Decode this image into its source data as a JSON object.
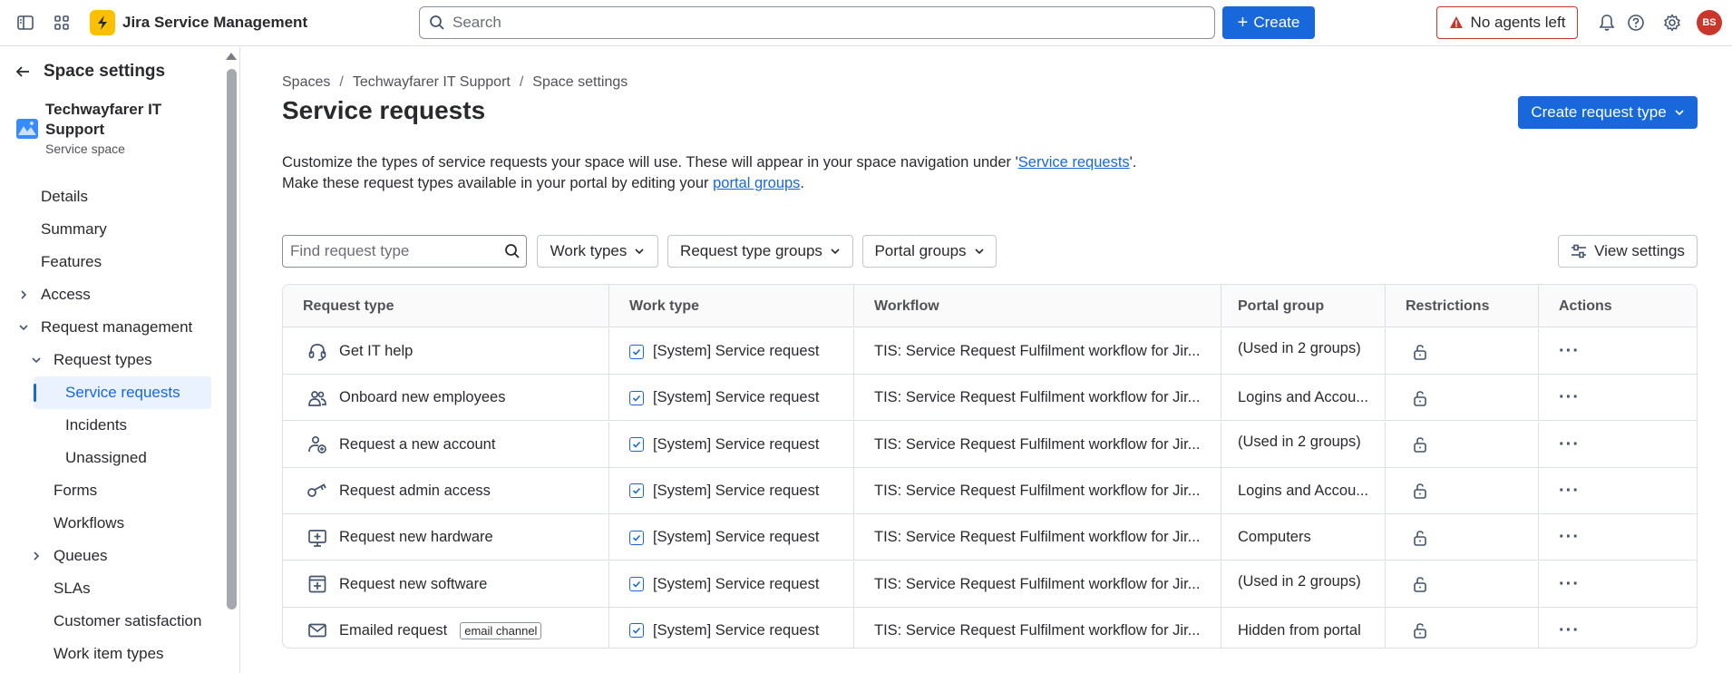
{
  "topnav": {
    "brand": "Jira Service Management",
    "search_placeholder": "Search",
    "create_label": "Create",
    "agents_label": "No agents left",
    "avatar_initials": "BS"
  },
  "sidebar": {
    "title": "Space settings",
    "space_name": "Techwayfarer IT Support",
    "space_type": "Service space",
    "items": {
      "details": "Details",
      "summary": "Summary",
      "features": "Features",
      "access": "Access",
      "request_management": "Request management",
      "request_types": "Request types",
      "service_requests": "Service requests",
      "incidents": "Incidents",
      "unassigned": "Unassigned",
      "forms": "Forms",
      "workflows": "Workflows",
      "queues": "Queues",
      "slas": "SLAs",
      "customer_satisfaction": "Customer satisfaction",
      "work_item_types": "Work item types"
    }
  },
  "main": {
    "breadcrumb": [
      "Spaces",
      "Techwayfarer IT Support",
      "Space settings"
    ],
    "title": "Service requests",
    "create_request_type": "Create request type",
    "desc_line1_pre": "Customize the types of service requests your space will use. These will appear in your space navigation under '",
    "desc_line1_link": "Service requests",
    "desc_line1_post": "'.",
    "desc_line2_pre": "Make these request types available in your portal by editing your ",
    "desc_line2_link": "portal groups",
    "desc_line2_post": ".",
    "find_placeholder": "Find request type",
    "filters": {
      "work_types": "Work types",
      "request_type_groups": "Request type groups",
      "portal_groups": "Portal groups"
    },
    "view_settings": "View settings",
    "table": {
      "headers": {
        "request_type": "Request type",
        "work_type": "Work type",
        "workflow": "Workflow",
        "portal_group": "Portal group",
        "restrictions": "Restrictions",
        "actions": "Actions"
      },
      "rows": [
        {
          "icon": "headset-icon",
          "name": "Get IT help",
          "badge": "",
          "work_type": "[System] Service request",
          "workflow": "TIS: Service Request Fulfilment workflow for Jir...",
          "portal_group": "(Used in 2 groups)"
        },
        {
          "icon": "people-icon",
          "name": "Onboard new employees",
          "badge": "",
          "work_type": "[System] Service request",
          "workflow": "TIS: Service Request Fulfilment workflow for Jir...",
          "portal_group": "Logins and Accou..."
        },
        {
          "icon": "person-add-icon",
          "name": "Request a new account",
          "badge": "",
          "work_type": "[System] Service request",
          "workflow": "TIS: Service Request Fulfilment workflow for Jir...",
          "portal_group": "(Used in 2 groups)"
        },
        {
          "icon": "key-icon",
          "name": "Request admin access",
          "badge": "",
          "work_type": "[System] Service request",
          "workflow": "TIS: Service Request Fulfilment workflow for Jir...",
          "portal_group": "Logins and Accou..."
        },
        {
          "icon": "monitor-add-icon",
          "name": "Request new hardware",
          "badge": "",
          "work_type": "[System] Service request",
          "workflow": "TIS: Service Request Fulfilment workflow for Jir...",
          "portal_group": "Computers"
        },
        {
          "icon": "window-add-icon",
          "name": "Request new software",
          "badge": "",
          "work_type": "[System] Service request",
          "workflow": "TIS: Service Request Fulfilment workflow for Jir...",
          "portal_group": "(Used in 2 groups)"
        },
        {
          "icon": "email-icon",
          "name": "Emailed request",
          "badge": "email channel",
          "work_type": "[System] Service request",
          "workflow": "TIS: Service Request Fulfilment workflow for Jir...",
          "portal_group": "Hidden from portal"
        }
      ]
    }
  }
}
